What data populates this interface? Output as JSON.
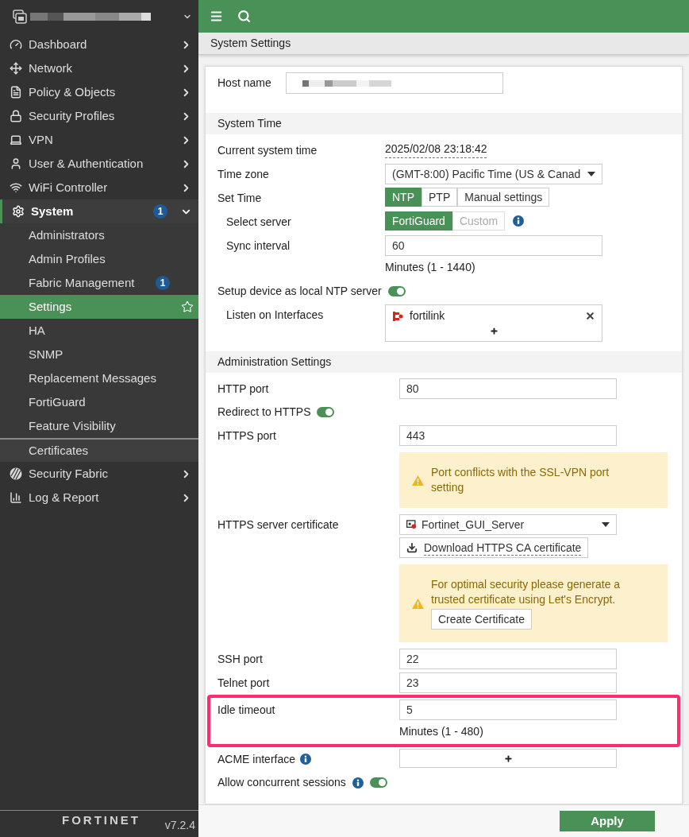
{
  "sidebar": {
    "items": [
      {
        "label": "Dashboard",
        "expanded": false
      },
      {
        "label": "Network",
        "expanded": false
      },
      {
        "label": "Policy & Objects",
        "expanded": false
      },
      {
        "label": "Security Profiles",
        "expanded": false
      },
      {
        "label": "VPN",
        "expanded": false
      },
      {
        "label": "User & Authentication",
        "expanded": false
      },
      {
        "label": "WiFi Controller",
        "expanded": false
      },
      {
        "label": "System",
        "expanded": true,
        "badge": "1",
        "children": [
          {
            "label": "Administrators",
            "selected": false,
            "separated": false
          },
          {
            "label": "Admin Profiles",
            "selected": false,
            "separated": false
          },
          {
            "label": "Fabric Management",
            "selected": false,
            "separated": false,
            "badge": "1"
          },
          {
            "label": "Settings",
            "selected": true,
            "separated": false
          },
          {
            "label": "HA",
            "selected": false,
            "separated": false
          },
          {
            "label": "SNMP",
            "selected": false,
            "separated": false
          },
          {
            "label": "Replacement Messages",
            "selected": false,
            "separated": false
          },
          {
            "label": "FortiGuard",
            "selected": false,
            "separated": false
          },
          {
            "label": "Feature Visibility",
            "selected": false,
            "separated": false
          },
          {
            "label": "Certificates",
            "selected": false,
            "separated": true
          }
        ]
      },
      {
        "label": "Security Fabric",
        "expanded": false
      },
      {
        "label": "Log & Report",
        "expanded": false
      }
    ],
    "logo": "FORTINET",
    "version": "v7.2.4"
  },
  "page_title": "System Settings",
  "host_name": {
    "label": "Host name"
  },
  "sections": [
    {
      "title": "System Time",
      "rows": [
        {
          "kind": "text",
          "label": "Current system time",
          "value": "2025/02/08 23:18:42"
        },
        {
          "kind": "select",
          "label": "Time zone",
          "value": "(GMT-8:00) Pacific Time (US & Canad"
        },
        {
          "kind": "segmented",
          "label": "Set Time",
          "info": false,
          "options": [
            {
              "label": "NTP",
              "selected": true,
              "disabled": false
            },
            {
              "label": "PTP",
              "selected": false,
              "disabled": false
            },
            {
              "label": "Manual settings",
              "selected": false,
              "disabled": false
            }
          ],
          "children": [
            {
              "kind": "segmented",
              "label": "Select server",
              "info": true,
              "options": [
                {
                  "label": "FortiGuard",
                  "selected": true,
                  "disabled": false
                },
                {
                  "label": "Custom",
                  "selected": false,
                  "disabled": true
                }
              ]
            },
            {
              "kind": "input",
              "label": "Sync interval",
              "value": "60",
              "hint": "Minutes (1 - 1440)"
            }
          ]
        },
        {
          "kind": "toggle",
          "label": "Setup device as local NTP server",
          "info": false,
          "on": true,
          "children": [
            {
              "kind": "interfaces",
              "label": "Listen on Interfaces",
              "items": [
                {
                  "name": "fortilink"
                }
              ]
            }
          ]
        }
      ]
    },
    {
      "title": "Administration Settings",
      "rows": [
        {
          "kind": "input",
          "label": "HTTP port",
          "value": "80",
          "highlighted": false
        },
        {
          "kind": "toggle",
          "label": "Redirect to HTTPS",
          "info": false,
          "on": true,
          "highlighted": false
        },
        {
          "kind": "input",
          "label": "HTTPS port",
          "value": "443",
          "highlighted": false
        },
        {
          "kind": "notice",
          "text": "Port conflicts with the SSL-VPN port setting",
          "highlighted": false
        },
        {
          "kind": "certificate",
          "label": "HTTPS server certificate",
          "value": "Fortinet_GUI_Server",
          "action": "Download HTTPS CA certificate",
          "highlighted": false
        },
        {
          "kind": "notice",
          "text": "For optimal security please generate a trusted certificate using Let's Encrypt.",
          "button": "Create Certificate",
          "highlighted": false
        },
        {
          "kind": "input",
          "label": "SSH port",
          "value": "22",
          "highlighted": false
        },
        {
          "kind": "input",
          "label": "Telnet port",
          "value": "23",
          "highlighted": false
        },
        {
          "kind": "input",
          "label": "Idle timeout",
          "value": "5",
          "hint": "Minutes (1 - 480)",
          "highlighted": true
        },
        {
          "kind": "add_field",
          "label": "ACME interface",
          "info": true,
          "highlighted": false
        },
        {
          "kind": "toggle",
          "label": "Allow concurrent sessions",
          "info": true,
          "on": true,
          "highlighted": false
        }
      ]
    }
  ],
  "apply_button": "Apply"
}
